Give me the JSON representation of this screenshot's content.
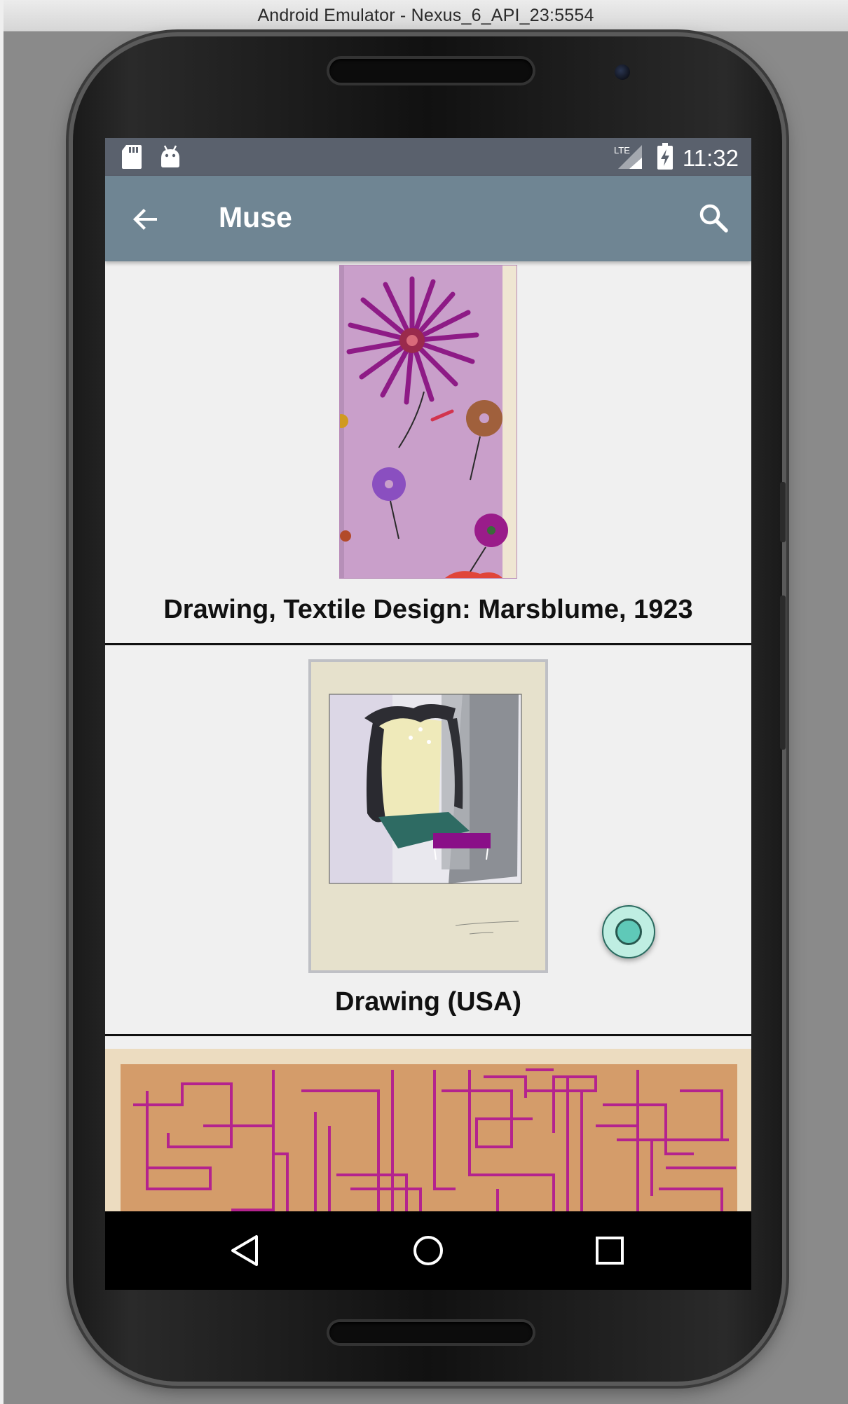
{
  "window": {
    "title": "Android Emulator - Nexus_6_API_23:5554"
  },
  "status_bar": {
    "time": "11:32",
    "network": "LTE",
    "left_icons": [
      "sd-card-icon",
      "android-debug-icon"
    ],
    "right_icons": [
      "lte-signal-icon",
      "battery-charging-icon"
    ]
  },
  "app_bar": {
    "title": "Muse",
    "back_icon": "arrow-back-icon",
    "search_icon": "search-icon"
  },
  "artworks": [
    {
      "title": "Drawing, Textile Design: Marsblume, 1923"
    },
    {
      "title": "Drawing (USA)"
    },
    {
      "title": ""
    }
  ],
  "fab": {
    "icon": "record-icon"
  },
  "nav_bar": {
    "buttons": [
      "back",
      "home",
      "recents"
    ]
  },
  "colors": {
    "status_bar": "#5a616d",
    "app_bar": "#6f8593",
    "fab": "#5fc9b8",
    "background": "#f0f0f0"
  }
}
